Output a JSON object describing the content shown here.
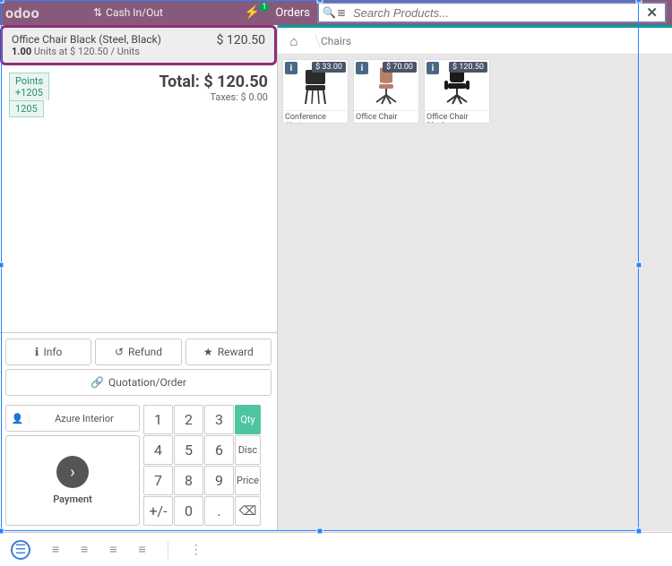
{
  "header": {
    "logo": "odoo",
    "cash_label": "Cash In/Out",
    "orders_label": "Orders",
    "orders_count": "1",
    "search_placeholder": "Search Products...",
    "clear_glyph": "✕"
  },
  "orderline": {
    "name": "Office Chair Black (Steel, Black)",
    "qty": "1.00",
    "unit_text": "Units at $ 120.50 / Units",
    "price": "$ 120.50"
  },
  "points": {
    "label": "Points",
    "delta": "+1205",
    "total": "1205"
  },
  "totals": {
    "label": "Total:",
    "amount": "$ 120.50",
    "taxes": "Taxes: $ 0.00"
  },
  "buttons": {
    "info": "Info",
    "refund": "Refund",
    "reward": "Reward",
    "quotation": "Quotation/Order"
  },
  "customer": {
    "name": "Azure Interior"
  },
  "payment": {
    "label": "Payment"
  },
  "numpad": {
    "k1": "1",
    "k2": "2",
    "k3": "3",
    "k4": "4",
    "k5": "5",
    "k6": "6",
    "k7": "7",
    "k8": "8",
    "k9": "9",
    "pm": "+/-",
    "k0": "0",
    "dot": ".",
    "qty": "Qty",
    "disc": "Disc",
    "price": "Price",
    "bksp": "⌫"
  },
  "breadcrumb": {
    "category": "Chairs"
  },
  "products": [
    {
      "name": "Conference Chair",
      "price": "$ 33.00",
      "color": "#2b2b2b",
      "kind": "conference"
    },
    {
      "name": "Office Chair",
      "price": "$ 70.00",
      "color": "#b8806b",
      "kind": "office"
    },
    {
      "name": "Office Chair Black",
      "price": "$ 120.50",
      "color": "#1a1a1a",
      "kind": "officeblack"
    }
  ]
}
